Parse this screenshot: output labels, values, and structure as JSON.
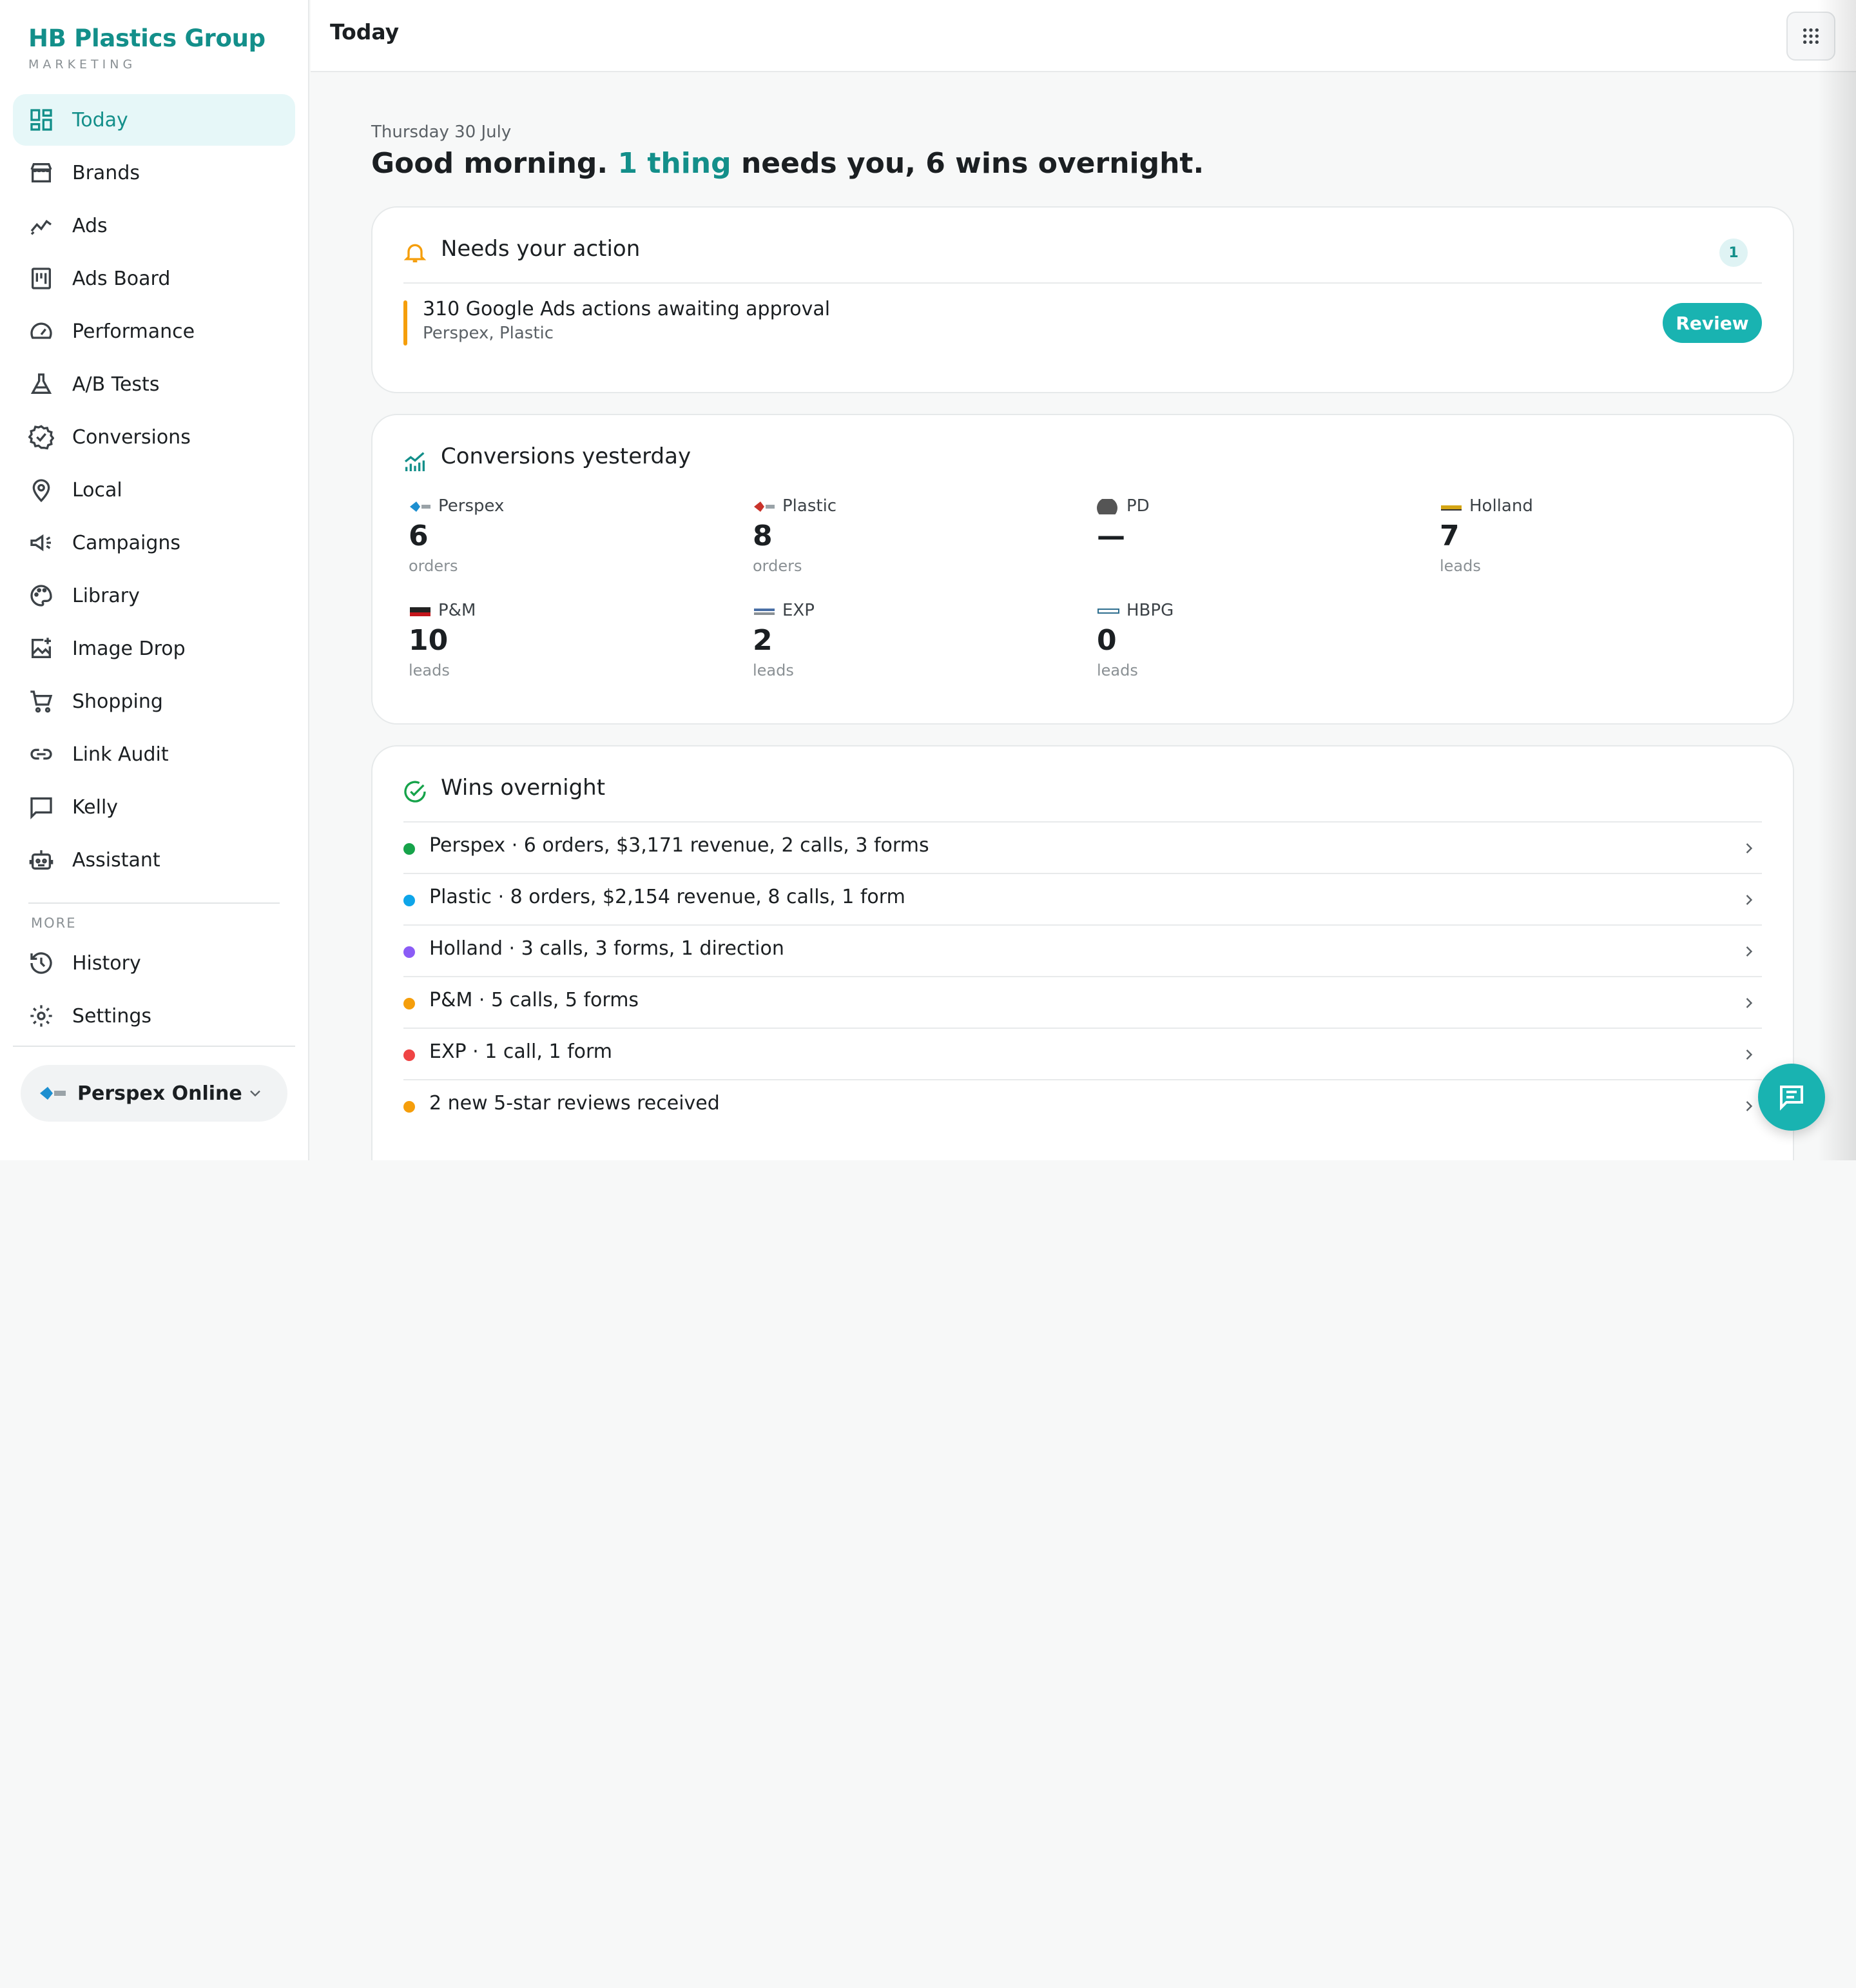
{
  "brand": {
    "name": "HB Plastics Group",
    "subtitle": "MARKETING"
  },
  "nav": {
    "items": [
      {
        "label": "Today",
        "icon": "dashboard-icon",
        "active": true
      },
      {
        "label": "Brands",
        "icon": "store-icon"
      },
      {
        "label": "Ads",
        "icon": "trend-icon"
      },
      {
        "label": "Ads Board",
        "icon": "board-icon"
      },
      {
        "label": "Performance",
        "icon": "gauge-icon"
      },
      {
        "label": "A/B Tests",
        "icon": "flask-icon"
      },
      {
        "label": "Conversions",
        "icon": "badge-check-icon"
      },
      {
        "label": "Local",
        "icon": "map-pin-icon"
      },
      {
        "label": "Campaigns",
        "icon": "megaphone-icon"
      },
      {
        "label": "Library",
        "icon": "palette-icon"
      },
      {
        "label": "Image Drop",
        "icon": "image-add-icon"
      },
      {
        "label": "Shopping",
        "icon": "cart-icon"
      },
      {
        "label": "Link Audit",
        "icon": "link-icon"
      },
      {
        "label": "Kelly",
        "icon": "chat-icon"
      },
      {
        "label": "Assistant",
        "icon": "robot-icon"
      }
    ],
    "more_heading": "MORE",
    "more_items": [
      {
        "label": "History",
        "icon": "history-icon"
      },
      {
        "label": "Settings",
        "icon": "gear-icon"
      }
    ],
    "org_switcher": "Perspex Online"
  },
  "topbar": {
    "title": "Today"
  },
  "main": {
    "date": "Thursday 30 July",
    "greeting": {
      "prefix": "Good morning.",
      "highlight": "1 thing",
      "suffix": "needs you, 6 wins overnight."
    }
  },
  "action_card": {
    "title": "Needs your action",
    "count": "1",
    "item": {
      "title": "310 Google Ads actions awaiting approval",
      "subtitle": "Perspex, Plastic",
      "button": "Review"
    }
  },
  "conversions_card": {
    "title": "Conversions yesterday",
    "brands": [
      {
        "name": "Perspex",
        "value": "6",
        "unit": "orders",
        "logo_color": "#1d8fd0"
      },
      {
        "name": "Plastic",
        "value": "8",
        "unit": "orders",
        "logo_color": "#c9332b"
      },
      {
        "name": "PD",
        "value": "—",
        "unit": "",
        "logo_color": "#555555"
      },
      {
        "name": "Holland",
        "value": "7",
        "unit": "leads",
        "logo_color": "#d4a514"
      },
      {
        "name": "P&M",
        "value": "10",
        "unit": "leads",
        "logo_color": "#c4161c"
      },
      {
        "name": "EXP",
        "value": "2",
        "unit": "leads",
        "logo_color": "#4a6fa5"
      },
      {
        "name": "HBPG",
        "value": "0",
        "unit": "leads",
        "logo_color": "#2f6f8f"
      }
    ]
  },
  "wins_card": {
    "title": "Wins overnight",
    "items": [
      {
        "text": "Perspex · 6 orders, $3,171 revenue, 2 calls, 3 forms",
        "color": "#16a34a"
      },
      {
        "text": "Plastic · 8 orders, $2,154 revenue, 8 calls, 1 form",
        "color": "#0ea5e9"
      },
      {
        "text": "Holland · 3 calls, 3 forms, 1 direction",
        "color": "#8b5cf6"
      },
      {
        "text": "P&M · 5 calls, 5 forms",
        "color": "#f59e0b"
      },
      {
        "text": "EXP · 1 call, 1 form",
        "color": "#ef4444"
      },
      {
        "text": "2 new 5-star reviews received",
        "color": "#f59e0b"
      }
    ]
  },
  "colors": {
    "accent": "#138f8a",
    "button": "#19b3b1",
    "warning": "#f59e0b"
  }
}
